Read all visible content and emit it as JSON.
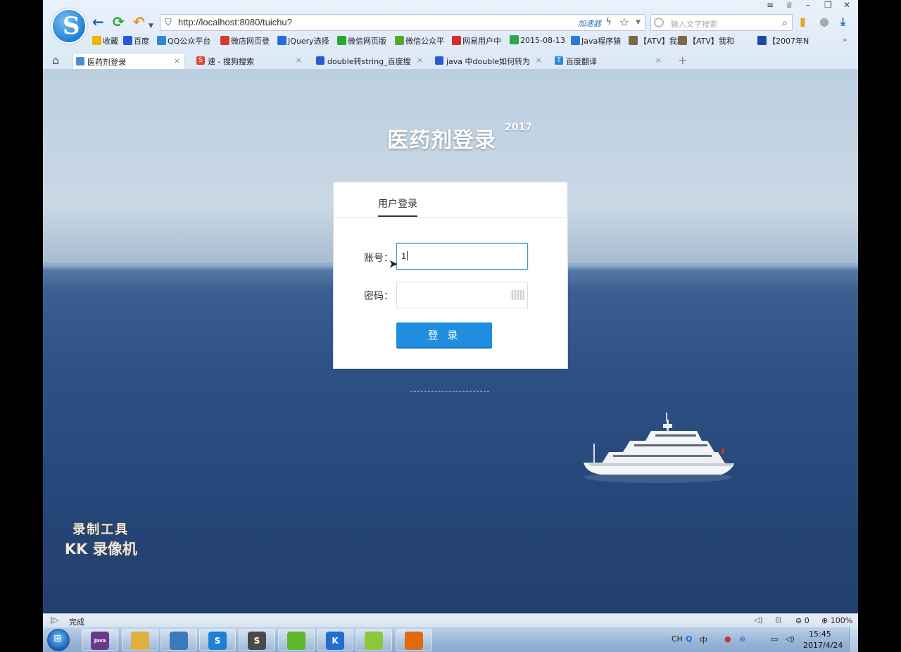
{
  "browser": {
    "logo_letter": "S",
    "url": "http://localhost:8080/tuichu?",
    "accelerator_label": "加速器",
    "search_placeholder": "输入文字搜索",
    "favorites": [
      {
        "label": "收藏",
        "color": "#f0b400"
      },
      {
        "label": "百度",
        "color": "#2a5bd7"
      },
      {
        "label": "QQ公众平台",
        "color": "#2a8ad8"
      },
      {
        "label": "微店网页登",
        "color": "#d83a2a"
      },
      {
        "label": "JQuery选择",
        "color": "#2a6ad7"
      },
      {
        "label": "微信网页版",
        "color": "#2aa832"
      },
      {
        "label": "微信公众平",
        "color": "#5aa82a"
      },
      {
        "label": "网易用户中",
        "color": "#d82a2a"
      },
      {
        "label": "2015-08-13",
        "color": "#2aa850"
      },
      {
        "label": "Java程序猿",
        "color": "#2a7ad8"
      },
      {
        "label": "【ATV】我和",
        "color": "#7a6a4a"
      },
      {
        "label": "【ATV】我和",
        "color": "#7a6a4a"
      },
      {
        "label": "【2007年N",
        "color": "#1d4a9a"
      }
    ],
    "favorites_overflow": "»",
    "tabs": [
      {
        "title": "医药剂登录",
        "icon_color": "#4a8ad8",
        "icon": "",
        "active": true
      },
      {
        "title": "速 - 搜狗搜索",
        "icon_color": "#e04a3a",
        "icon": "S",
        "active": false
      },
      {
        "title": "double转string_百度搜",
        "icon_color": "#2a5bd7",
        "icon": "",
        "active": false
      },
      {
        "title": "java 中double如何转为",
        "icon_color": "#2a5bd7",
        "icon": "",
        "active": false
      },
      {
        "title": "百度翻译",
        "icon_color": "#2a8ad8",
        "icon": "T",
        "active": false
      }
    ],
    "new_tab": "+"
  },
  "page": {
    "title": "医药剂登录",
    "year": "2017",
    "login_tab": "用户登录",
    "account_label": "账号：",
    "account_value": "1",
    "password_label": "密码：",
    "login_button": "登 录",
    "watermark_line1": "录制工具",
    "watermark_line2": "KK 录像机"
  },
  "statusbar": {
    "status": "完成",
    "blocked_count": "0",
    "zoom": "100%"
  },
  "taskbar": {
    "apps": [
      {
        "name": "java-ee-ide",
        "label": "Java EE",
        "color": "#6a3a8a"
      },
      {
        "name": "file-explorer",
        "label": "",
        "color": "#e0b040"
      },
      {
        "name": "image-viewer",
        "label": "",
        "color": "#3a7ab8"
      },
      {
        "name": "sogou-browser",
        "label": "S",
        "color": "#1f7fd6"
      },
      {
        "name": "sublime-text",
        "label": "S",
        "color": "#4a4a4a"
      },
      {
        "name": "green-app",
        "label": "",
        "color": "#5ab82a"
      },
      {
        "name": "kk-recorder",
        "label": "K",
        "color": "#1f6fd0"
      },
      {
        "name": "android-app",
        "label": "",
        "color": "#8ac83a"
      },
      {
        "name": "fox-app",
        "label": "",
        "color": "#e06a10"
      }
    ],
    "input_lang": "CH",
    "ime_mode": "中",
    "time": "15:45",
    "date": "2017/4/24"
  }
}
